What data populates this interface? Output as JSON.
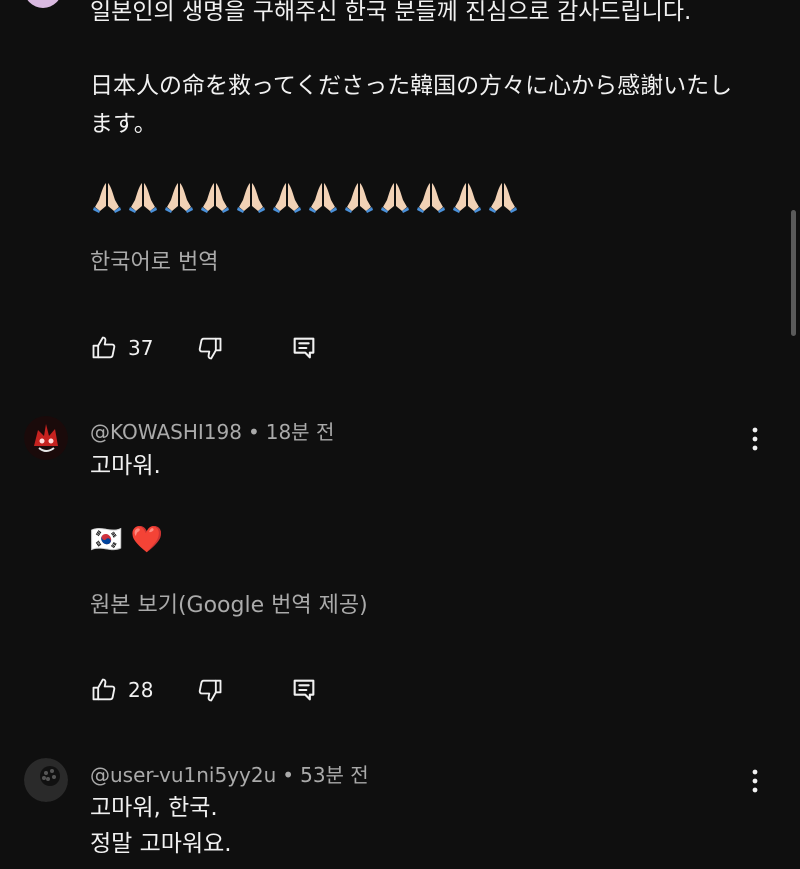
{
  "comments": [
    {
      "lines": [
        "일본인의 생명을 구해주신 한국 분들께 진심으로 감사드립니다.",
        "日本人の命を救ってくださった韓国の方々に心から感謝いたし",
        "ます。"
      ],
      "emoji_row": "🙏🏻🙏🏻🙏🏻🙏🏻🙏🏻🙏🏻🙏🏻🙏🏻🙏🏻🙏🏻🙏🏻🙏🏻",
      "translate_label": "한국어로 번역",
      "likes": "37"
    },
    {
      "author": "@KOWASHI198",
      "time": "18분 전",
      "lines": [
        "고마워."
      ],
      "emoji_line": "🇰🇷 ❤️",
      "translate_label": "원본 보기(Google 번역 제공)",
      "likes": "28"
    },
    {
      "author": "@user-vu1ni5yy2u",
      "time": "53분 전",
      "lines": [
        "고마워, 한국.",
        "정말 고마워요."
      ]
    }
  ],
  "icons": {
    "like": "thumbs-up-icon",
    "dislike": "thumbs-down-icon",
    "reply": "reply-comment-icon",
    "more": "more-vert-icon"
  },
  "colors": {
    "background": "#0f0f0f",
    "text": "#f1f1f1",
    "secondary": "#aaaaaa"
  }
}
